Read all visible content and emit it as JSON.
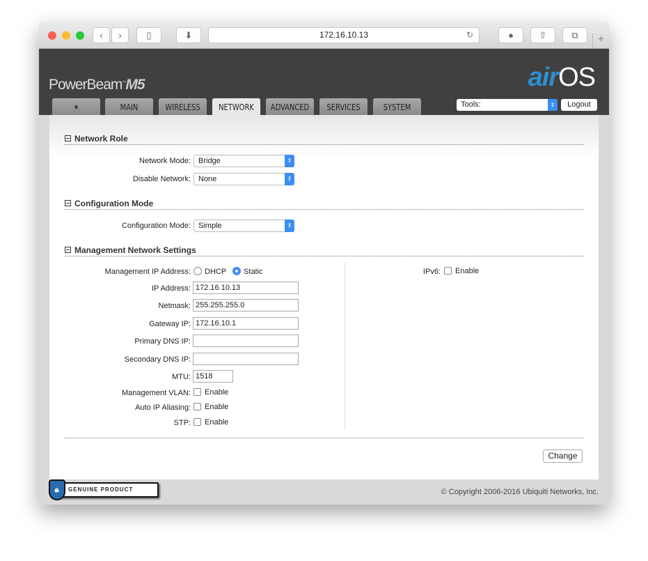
{
  "browser": {
    "url": "172.16.10.13"
  },
  "header": {
    "brand": "PowerBeam",
    "brand_model": "M5",
    "logo_air": "air",
    "logo_os": "OS",
    "tabs": [
      "MAIN",
      "WIRELESS",
      "NETWORK",
      "ADVANCED",
      "SERVICES",
      "SYSTEM"
    ],
    "active_tab": "NETWORK",
    "tools_label": "Tools:",
    "logout": "Logout"
  },
  "network_role": {
    "title": "Network Role",
    "network_mode_label": "Network Mode:",
    "network_mode": "Bridge",
    "disable_network_label": "Disable Network:",
    "disable_network": "None"
  },
  "configuration_mode": {
    "title": "Configuration Mode",
    "label": "Configuration Mode:",
    "value": "Simple"
  },
  "management": {
    "title": "Management Network Settings",
    "ip_mode_label": "Management IP Address:",
    "dhcp": "DHCP",
    "static": "Static",
    "selected": "Static",
    "ip_label": "IP Address:",
    "ip": "172.16.10.13",
    "netmask_label": "Netmask:",
    "netmask": "255.255.255.0",
    "gateway_label": "Gateway IP:",
    "gateway": "172.16.10.1",
    "dns1_label": "Primary DNS IP:",
    "dns1": "",
    "dns2_label": "Secondary DNS IP:",
    "dns2": "",
    "mtu_label": "MTU:",
    "mtu": "1518",
    "vlan_label": "Management VLAN:",
    "aliasing_label": "Auto IP Aliasing:",
    "stp_label": "STP:",
    "enable": "Enable",
    "ipv6_label": "IPv6:"
  },
  "change": "Change",
  "footer": {
    "badge": "GENUINE PRODUCT",
    "copyright": "© Copyright 2006-2016 Ubiquiti Networks, Inc."
  }
}
